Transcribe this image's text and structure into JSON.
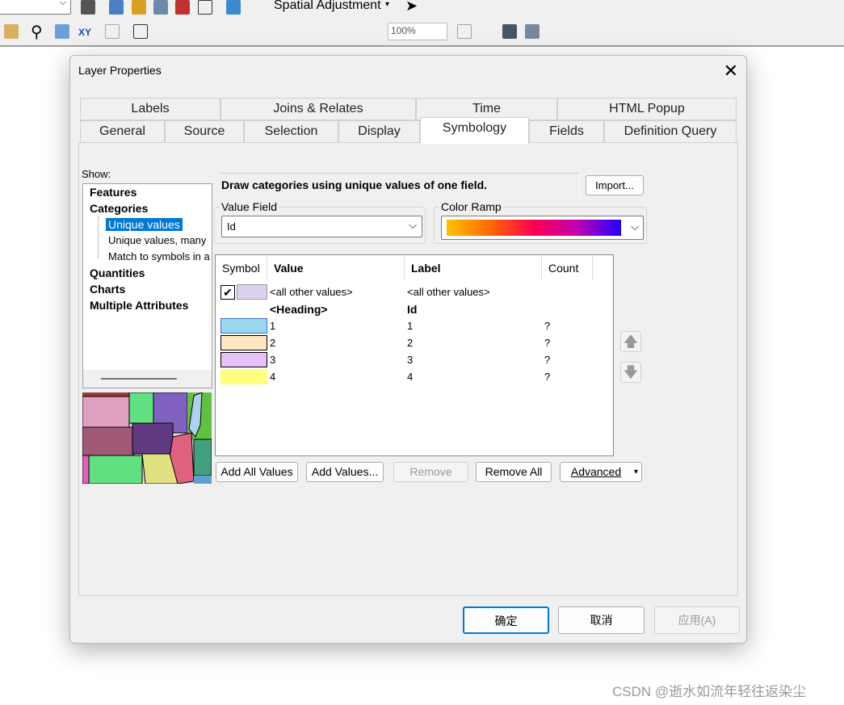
{
  "toolbar": {
    "spatial_adjustment": "Spatial Adjustment",
    "zoom_level": "100%"
  },
  "dialog": {
    "title": "Layer Properties",
    "tabs_row1": [
      "Labels",
      "Joins & Relates",
      "Time",
      "HTML Popup"
    ],
    "tabs_row2": [
      "General",
      "Source",
      "Selection",
      "Display",
      "Symbology",
      "Fields",
      "Definition Query"
    ],
    "active_tab": "Symbology",
    "show_label": "Show:",
    "tree": {
      "features": "Features",
      "categories": "Categories",
      "unique_values": "Unique values",
      "unique_values_many": "Unique values, many",
      "match_symbols": "Match to symbols in a",
      "quantities": "Quantities",
      "charts": "Charts",
      "multiple_attributes": "Multiple Attributes"
    },
    "description": "Draw categories using unique values of one field.",
    "import_button": "Import...",
    "value_field": {
      "label": "Value Field",
      "value": "Id"
    },
    "color_ramp": {
      "label": "Color Ramp",
      "colors": [
        "#ffc000",
        "#ff6a00",
        "#ff0050",
        "#c000b0",
        "#2000ff"
      ]
    },
    "table": {
      "headers": [
        "Symbol",
        "Value",
        "Label",
        "Count"
      ],
      "rows": [
        {
          "color": "#dcd2f0",
          "value": "<all other values>",
          "label": "<all other values>",
          "count": "",
          "checked": true
        },
        {
          "color": "",
          "value": "<Heading>",
          "label": "Id",
          "count": "",
          "heading": true
        },
        {
          "color": "#9ad8f0",
          "value": "1",
          "label": "1",
          "count": "?"
        },
        {
          "color": "#ffe6c0",
          "value": "2",
          "label": "2",
          "count": "?"
        },
        {
          "color": "#e6c0f8",
          "value": "3",
          "label": "3",
          "count": "?"
        },
        {
          "color": "#ffff80",
          "value": "4",
          "label": "4",
          "count": "?"
        }
      ]
    },
    "buttons": {
      "add_all": "Add All Values",
      "add_values": "Add Values...",
      "remove": "Remove",
      "remove_all": "Remove All",
      "advanced": "Advanced"
    },
    "footer": {
      "ok": "确定",
      "cancel": "取消",
      "apply": "应用(A)"
    }
  },
  "watermark": "CSDN @逝水如流年轻往返染尘"
}
